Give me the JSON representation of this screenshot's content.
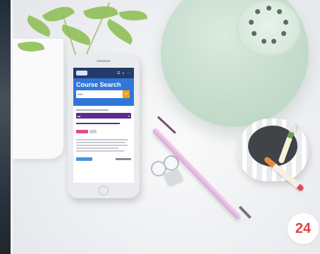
{
  "screen_app": {
    "title": "Course Search",
    "search_value": "BBC"
  },
  "badge": {
    "text": "24"
  },
  "colors": {
    "lamp": "#c9dfd0",
    "phone_header": "#243a67",
    "phone_search_panel": "#3177d8",
    "badge_text": "#e34343",
    "pen": "#d8a6d6"
  }
}
